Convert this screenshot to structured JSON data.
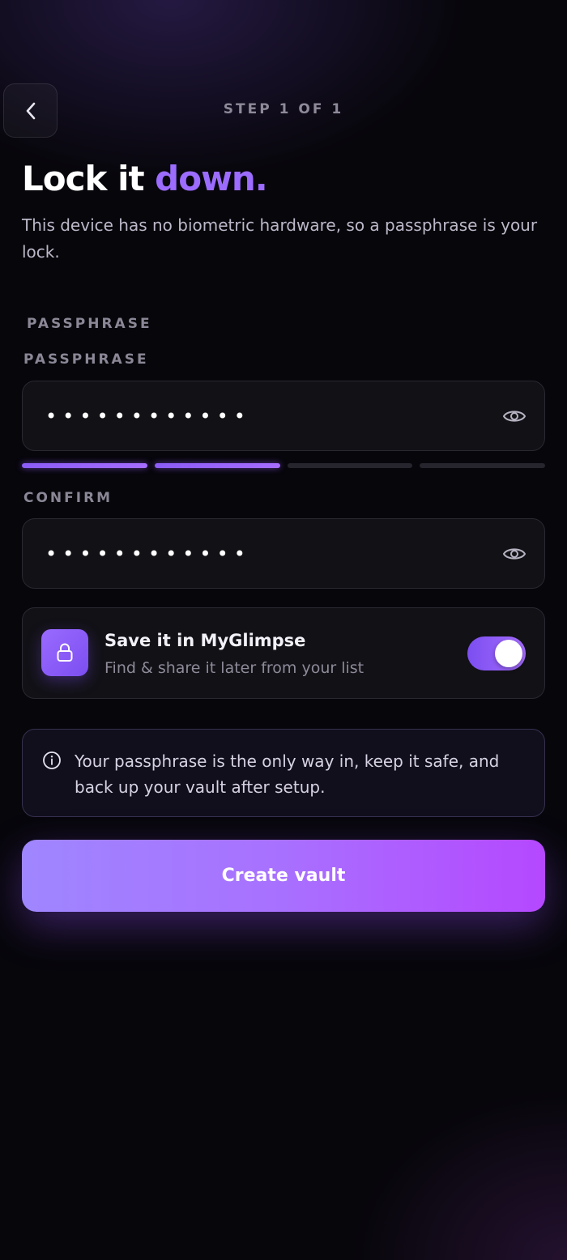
{
  "header": {
    "back_icon": "chevron-left-icon",
    "step_label": "STEP 1 OF 1"
  },
  "title": {
    "main": "Lock it ",
    "accent": "down.",
    "accent_color": "#9c6cff"
  },
  "subtitle": "This device has no biometric hardware, so a passphrase is your lock.",
  "section_label": "PASSPHRASE",
  "passphrase": {
    "label": "PASSPHRASE",
    "masked_value": "••••••••••••",
    "toggle_icon": "eye-icon",
    "strength": {
      "segments_total": 4,
      "segments_filled": 2
    }
  },
  "confirm": {
    "label": "CONFIRM",
    "masked_value": "••••••••••••",
    "toggle_icon": "eye-icon"
  },
  "save_option": {
    "icon": "lock-icon",
    "title": "Save it in MyGlimpse",
    "subtitle": "Find & share it later from your list",
    "enabled": true
  },
  "info": {
    "icon": "info-icon",
    "text": "Your passphrase is the only way in, keep it safe, and back up your vault after setup."
  },
  "cta": {
    "label": "Create vault",
    "gradient": [
      "#9f86ff",
      "#b548ff"
    ]
  }
}
